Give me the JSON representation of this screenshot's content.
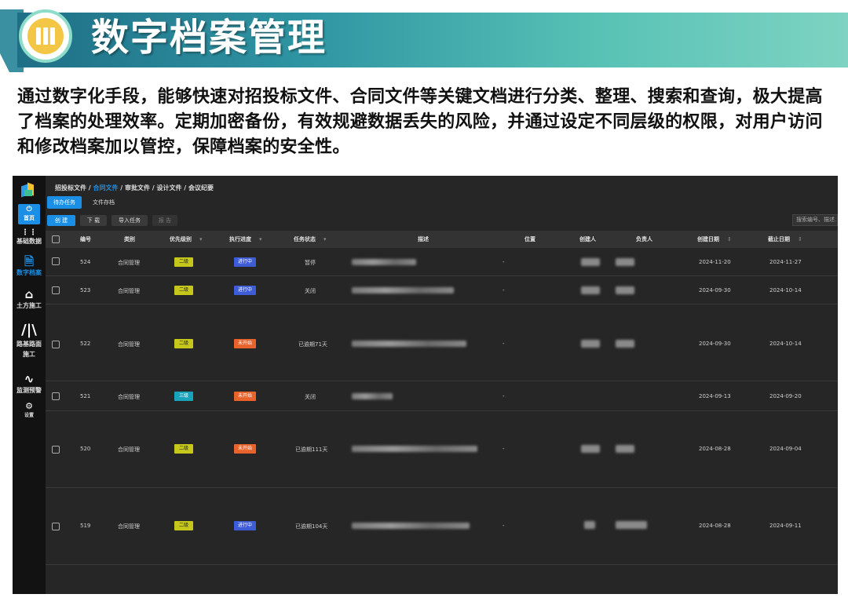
{
  "banner": {
    "title": "数字档案管理"
  },
  "description": "通过数字化手段，能够快速对招投标文件、合同文件等关键文档进行分类、整理、搜索和查询，极大提高了档案的处理效率。定期加密备份，有效规避数据丢失的风险，并通过设定不同层级的权限，对用户访问和修改档案加以管控，保障档案的安全性。",
  "colors": {
    "accent": "#1b8fe6",
    "banner_start": "#1f6f86",
    "banner_end": "#7ed3c2",
    "priority_yellow": "#c5c81b",
    "priority_teal": "#19a3b8",
    "status_blue": "#3d5cd6",
    "status_orange": "#e8622b"
  },
  "sidebar": {
    "items": [
      {
        "label": "首页",
        "icon": "home-icon"
      },
      {
        "label": "基础数据",
        "icon": "grid-icon"
      },
      {
        "label": "数字档案",
        "icon": "document-icon"
      },
      {
        "label": "土方施工",
        "icon": "excavator-icon"
      },
      {
        "label": "路基路面施工",
        "icon": "road-icon"
      },
      {
        "label": "监测预警",
        "icon": "pulse-icon"
      },
      {
        "label": "设置",
        "icon": "gear-icon"
      }
    ]
  },
  "breadcrumb": {
    "parts": [
      "招投标文件 / ",
      "合同文件",
      " / 审批文件 / 设计文件 / 会议纪要"
    ]
  },
  "tabs": [
    "待办任务",
    "文件存档"
  ],
  "toolbar": {
    "create": "创 建",
    "download": "下 载",
    "import": "导入任务",
    "report": "报 告",
    "search_placeholder": "搜索编号、描述..."
  },
  "table": {
    "headers": [
      "编号",
      "类别",
      "优先级别",
      "执行进度",
      "任务状态",
      "描述",
      "位置",
      "创建人",
      "负责人",
      "创建日期",
      "截止日期"
    ],
    "rows": [
      {
        "id": "524",
        "category": "合同管理",
        "priority": "二级",
        "progress": "进行中",
        "status": "暂停",
        "location": "-",
        "created": "2024-11-20",
        "deadline": "2024-11-27"
      },
      {
        "id": "523",
        "category": "合同管理",
        "priority": "二级",
        "progress": "进行中",
        "status": "关闭",
        "location": "-",
        "created": "2024-09-30",
        "deadline": "2024-10-14"
      },
      {
        "id": "522",
        "category": "合同管理",
        "priority": "二级",
        "progress": "未开始",
        "status": "已逾期71天",
        "location": "-",
        "created": "2024-09-30",
        "deadline": "2024-10-14"
      },
      {
        "id": "521",
        "category": "合同管理",
        "priority": "三级",
        "progress": "未开始",
        "status": "关闭",
        "location": "-",
        "created": "2024-09-13",
        "deadline": "2024-09-20"
      },
      {
        "id": "520",
        "category": "合同管理",
        "priority": "二级",
        "progress": "未开始",
        "status": "已逾期111天",
        "location": "-",
        "created": "2024-08-28",
        "deadline": "2024-09-04"
      },
      {
        "id": "519",
        "category": "合同管理",
        "priority": "二级",
        "progress": "进行中",
        "status": "已逾期104天",
        "location": "-",
        "created": "2024-08-28",
        "deadline": "2024-09-11"
      }
    ]
  }
}
